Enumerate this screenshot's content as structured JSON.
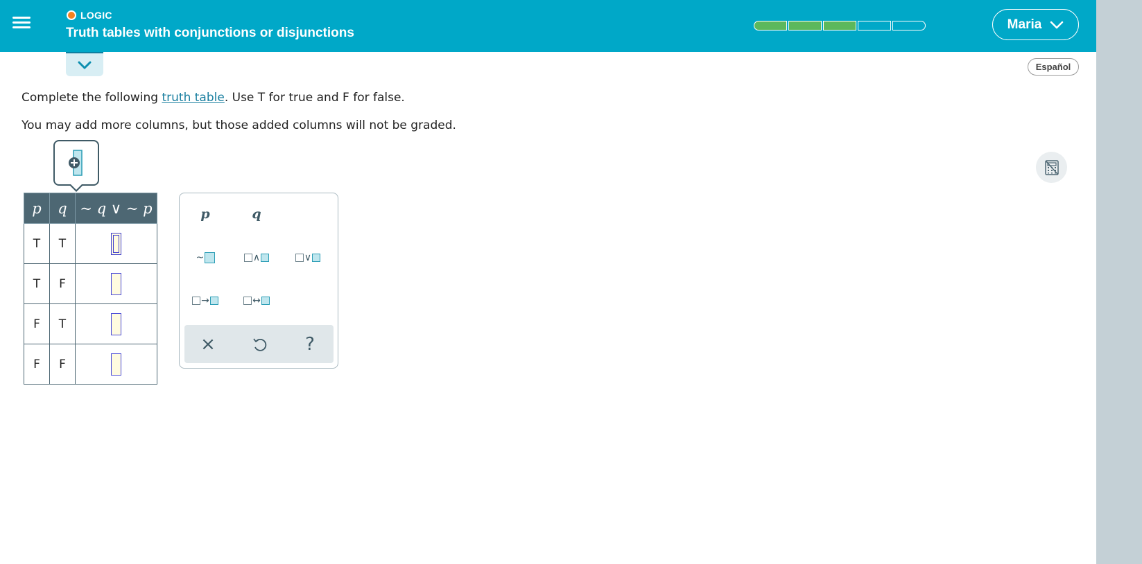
{
  "header": {
    "topic": "LOGIC",
    "title": "Truth tables with conjunctions or disjunctions",
    "progress": {
      "filled": 3,
      "total": 5
    },
    "user_name": "Maria"
  },
  "language_button": "Español",
  "instructions": {
    "before_link": "Complete the following ",
    "link": "truth table",
    "after_link": ". Use T for true and F for false.",
    "note": "You may add more columns, but those added columns will not be graded."
  },
  "table": {
    "headers": [
      "p",
      "q",
      "~ q ∨ ~ p"
    ],
    "rows": [
      {
        "p": "T",
        "q": "T"
      },
      {
        "p": "T",
        "q": "F"
      },
      {
        "p": "F",
        "q": "T"
      },
      {
        "p": "F",
        "q": "F"
      }
    ]
  },
  "palette": {
    "variables": [
      "p",
      "q"
    ],
    "operators": {
      "negation": "~",
      "and": "∧",
      "or": "∨",
      "implies": "→",
      "iff": "↔"
    },
    "footer": {
      "clear": "×",
      "undo": "undo-icon",
      "help": "?"
    }
  },
  "colors": {
    "header_bg": "#00a8c8",
    "table_header_bg": "#4d6773",
    "progress_fill": "#5cb85c",
    "topic_dot": "#f58220",
    "right_rail": "#c4d0d6"
  }
}
